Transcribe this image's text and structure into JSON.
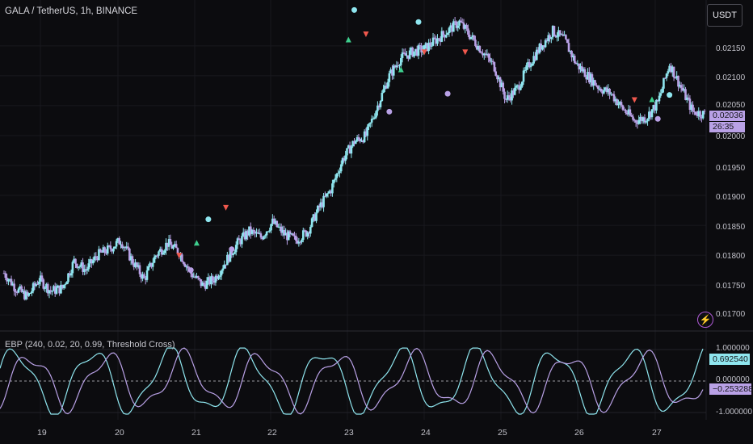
{
  "header": {
    "title": "GALA / TetherUS, 1h, BINANCE",
    "currency_button": "USDT"
  },
  "price_axis": {
    "labels": [
      "0.02150",
      "0.02100",
      "0.02050",
      "0.02000",
      "0.01950",
      "0.01900",
      "0.01850",
      "0.01800",
      "0.01750",
      "0.01700"
    ],
    "current_price": "0.02036",
    "countdown": "26:35",
    "tag_color": "#b9a1e6"
  },
  "indicator": {
    "label": "EBP (240, 0.02, 20, 0.99, Threshold Cross)",
    "axis_labels": [
      "1.000000",
      "0.000000",
      "-1.000000"
    ],
    "value_up": "0.692540",
    "value_down": "−0.253288",
    "color_cyan": "#8fe6ef",
    "color_purple": "#b9a1e6"
  },
  "time_axis": {
    "labels": [
      "19",
      "20",
      "21",
      "22",
      "23",
      "24",
      "25",
      "26",
      "27"
    ]
  },
  "colors": {
    "bull": "#8fe6ef",
    "bear": "#b9a1e6",
    "up_marker": "#3ecf8e",
    "down_marker": "#f0584d",
    "background": "#0c0c0f"
  },
  "icons": {
    "bottom_right": "lightning-icon"
  },
  "chart_data": {
    "type": "candlestick",
    "title": "GALA / TetherUS, 1h, BINANCE",
    "ylim": [
      0.0168,
      0.0222
    ],
    "x_ticks": [
      "19",
      "20",
      "21",
      "22",
      "23",
      "24",
      "25",
      "26",
      "27"
    ],
    "close_path": [
      [
        0,
        0.0177
      ],
      [
        2,
        0.01745
      ],
      [
        4,
        0.0173
      ],
      [
        6,
        0.0176
      ],
      [
        8,
        0.0174
      ],
      [
        10,
        0.01745
      ],
      [
        12,
        0.0179
      ],
      [
        14,
        0.01775
      ],
      [
        16,
        0.018
      ],
      [
        18,
        0.0181
      ],
      [
        20,
        0.01825
      ],
      [
        22,
        0.0179
      ],
      [
        24,
        0.0176
      ],
      [
        26,
        0.018
      ],
      [
        28,
        0.0182
      ],
      [
        30,
        0.01805
      ],
      [
        32,
        0.0177
      ],
      [
        34,
        0.0175
      ],
      [
        36,
        0.0176
      ],
      [
        38,
        0.0179
      ],
      [
        40,
        0.0182
      ],
      [
        42,
        0.0184
      ],
      [
        44,
        0.0183
      ],
      [
        46,
        0.01855
      ],
      [
        48,
        0.01835
      ],
      [
        50,
        0.01825
      ],
      [
        52,
        0.0184
      ],
      [
        54,
        0.0188
      ],
      [
        56,
        0.0191
      ],
      [
        58,
        0.0196
      ],
      [
        60,
        0.0199
      ],
      [
        62,
        0.02
      ],
      [
        64,
        0.0205
      ],
      [
        66,
        0.021
      ],
      [
        68,
        0.0213
      ],
      [
        70,
        0.0214
      ],
      [
        72,
        0.02145
      ],
      [
        74,
        0.0216
      ],
      [
        76,
        0.02175
      ],
      [
        78,
        0.0219
      ],
      [
        80,
        0.02165
      ],
      [
        82,
        0.0214
      ],
      [
        84,
        0.02115
      ],
      [
        86,
        0.0206
      ],
      [
        88,
        0.0208
      ],
      [
        90,
        0.0212
      ],
      [
        92,
        0.0215
      ],
      [
        94,
        0.02175
      ],
      [
        96,
        0.0216
      ],
      [
        98,
        0.0212
      ],
      [
        100,
        0.021
      ],
      [
        102,
        0.0208
      ],
      [
        104,
        0.0207
      ],
      [
        106,
        0.02045
      ],
      [
        108,
        0.02025
      ],
      [
        110,
        0.0203
      ],
      [
        112,
        0.02055
      ],
      [
        114,
        0.0212
      ],
      [
        116,
        0.0208
      ],
      [
        118,
        0.0204
      ],
      [
        120,
        0.02036
      ]
    ],
    "markers": {
      "up": [
        [
          33,
          0.0182
        ],
        [
          59,
          0.0216
        ],
        [
          68,
          0.0211
        ],
        [
          111,
          0.0206
        ]
      ],
      "down": [
        [
          30,
          0.018
        ],
        [
          38,
          0.0188
        ],
        [
          62,
          0.0217
        ],
        [
          72,
          0.0214
        ],
        [
          79,
          0.0214
        ],
        [
          108,
          0.0206
        ]
      ],
      "dot_cyan": [
        [
          35,
          0.0186
        ],
        [
          60,
          0.0221
        ],
        [
          71,
          0.0219
        ],
        [
          114,
          0.02068
        ]
      ],
      "dot_purple": [
        [
          32,
          0.01775
        ],
        [
          39,
          0.0181
        ],
        [
          66,
          0.0204
        ],
        [
          76,
          0.0207
        ],
        [
          112,
          0.02028
        ]
      ]
    },
    "indicator_series": [
      {
        "color": "cyan",
        "range": [
          -1,
          1
        ]
      },
      {
        "color": "purple",
        "range": [
          -1,
          1
        ]
      }
    ]
  }
}
